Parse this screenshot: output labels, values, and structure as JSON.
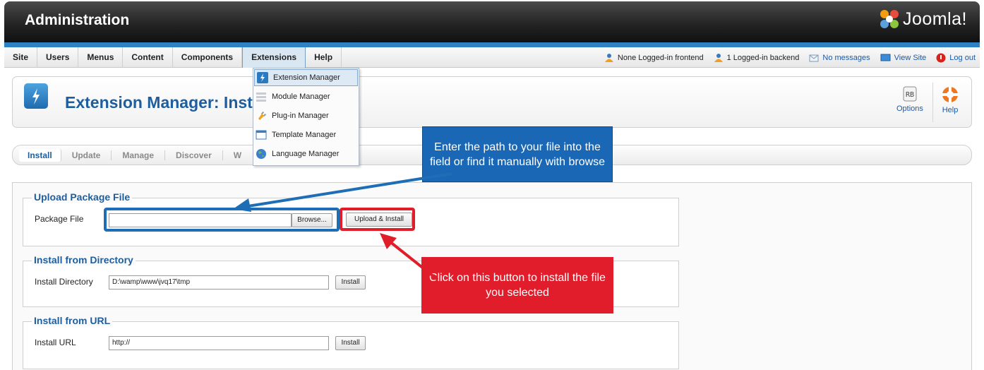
{
  "header": {
    "title": "Administration",
    "brand": "Joomla!"
  },
  "nav": {
    "menu": [
      "Site",
      "Users",
      "Menus",
      "Content",
      "Components",
      "Extensions",
      "Help"
    ],
    "status": {
      "frontend": "None Logged-in frontend",
      "backend": "1 Logged-in backend",
      "messages": "No messages",
      "view_site": "View Site",
      "logout": "Log out"
    }
  },
  "dropdown": {
    "items": [
      "Extension Manager",
      "Module Manager",
      "Plug-in Manager",
      "Template Manager",
      "Language Manager"
    ]
  },
  "toolbar": {
    "title": "Extension Manager: Insta",
    "options": "Options",
    "help": "Help"
  },
  "submenu": [
    "Install",
    "Update",
    "Manage",
    "Discover",
    "W"
  ],
  "upload": {
    "legend": "Upload Package File",
    "label": "Package File",
    "browse": "Browse...",
    "submit": "Upload & Install"
  },
  "directory": {
    "legend": "Install from Directory",
    "label": "Install Directory",
    "value": "D:\\wamp\\www\\jvq17\\tmp",
    "button": "Install"
  },
  "url": {
    "legend": "Install from URL",
    "label": "Install URL",
    "value": "http://",
    "button": "Install"
  },
  "annotations": {
    "blue": "Enter the path to your file into the field or find it manually with browse",
    "red": "Click on this button to install the file you selected"
  },
  "colors": {
    "accent": "#2e82c4",
    "title": "#1e5e9e",
    "annotation_blue": "#1a67b5",
    "annotation_red": "#e21d2b"
  }
}
